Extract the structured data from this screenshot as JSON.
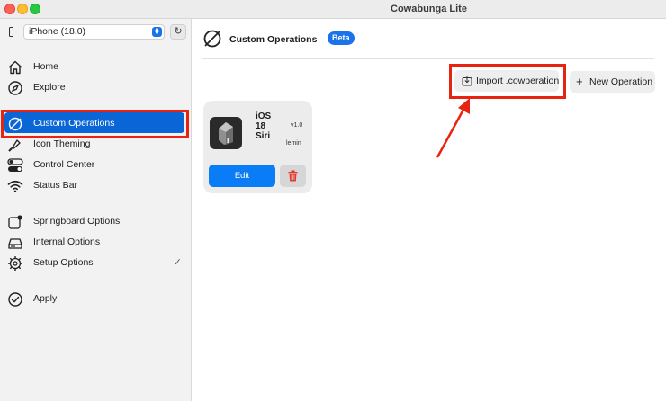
{
  "window": {
    "title": "Cowabunga Lite"
  },
  "device_selector": {
    "value": "iPhone (18.0)"
  },
  "sidebar": {
    "items": [
      {
        "label": "Home",
        "icon": "house-icon"
      },
      {
        "label": "Explore",
        "icon": "compass-icon"
      },
      {
        "label": "Custom Operations",
        "icon": "custom-operations-icon",
        "selected": true
      },
      {
        "label": "Icon Theming",
        "icon": "paintbrush-icon"
      },
      {
        "label": "Control Center",
        "icon": "toggles-icon"
      },
      {
        "label": "Status Bar",
        "icon": "wifi-icon"
      },
      {
        "label": "Springboard Options",
        "icon": "app-badge-icon"
      },
      {
        "label": "Internal Options",
        "icon": "drive-icon"
      },
      {
        "label": "Setup Options",
        "icon": "gear-icon",
        "checkmark": "✓"
      },
      {
        "label": "Apply",
        "icon": "checkmark-circle-icon"
      }
    ]
  },
  "main": {
    "title": "Custom Operations",
    "badge": "Beta",
    "import_button": "Import .cowperation",
    "new_button": "New Operation",
    "operation_card": {
      "name": "iOS 18 Siri",
      "version": "v1.0",
      "author": "lemin",
      "edit_label": "Edit"
    }
  },
  "colors": {
    "accent": "#0a66d6",
    "highlight": "#e8230f",
    "badge": "#1a73e8"
  }
}
